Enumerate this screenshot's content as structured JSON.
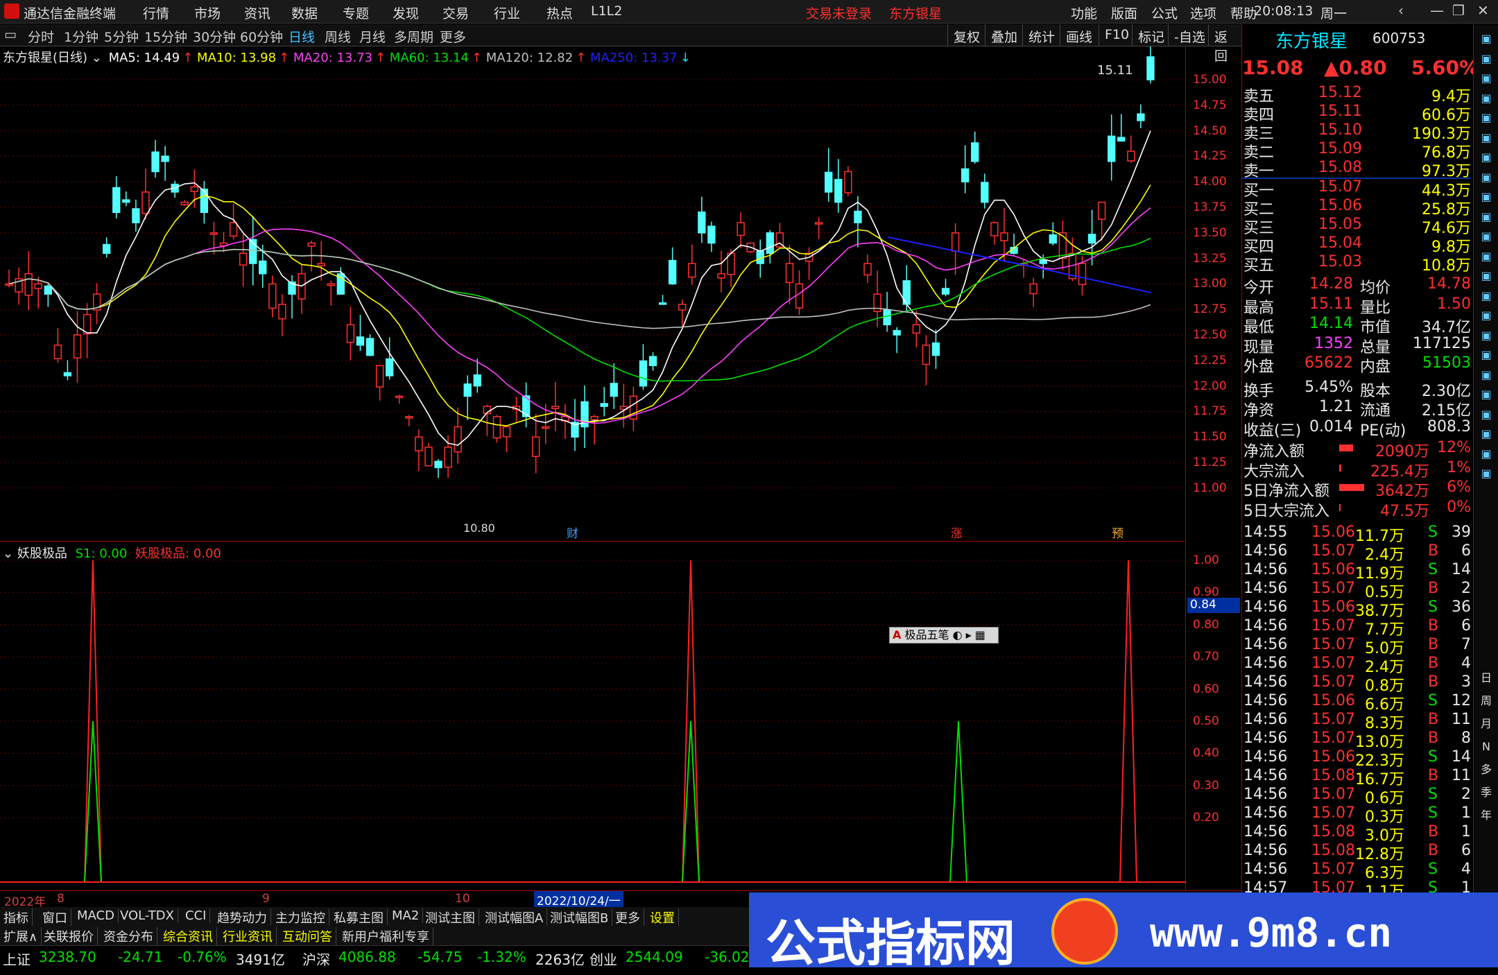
{
  "app": {
    "title": "通达信金融终端",
    "menus": [
      "行情",
      "市场",
      "资讯",
      "数据",
      "专题",
      "发现",
      "交易",
      "行业",
      "热点",
      "L1L2"
    ],
    "center_links": [
      "交易未登录",
      "东方银星"
    ],
    "right_menus": [
      "功能",
      "版面",
      "公式",
      "选项",
      "帮助"
    ],
    "clock": "20:08:13",
    "weekday": "周一"
  },
  "periods": {
    "items": [
      "分时",
      "1分钟",
      "5分钟",
      "15分钟",
      "30分钟",
      "60分钟",
      "日线",
      "周线",
      "月线",
      "多周期",
      "更多"
    ],
    "active": "日线",
    "right_buttons": [
      "复权",
      "叠加",
      "统计",
      "画线",
      "F10",
      "标记",
      "-自选",
      "返回"
    ]
  },
  "main_legend": {
    "name": "东方银星(日线)",
    "ma": [
      {
        "label": "MA5: 14.49",
        "color": "#ffffff"
      },
      {
        "label": "MA10: 13.98",
        "color": "#ffff00"
      },
      {
        "label": "MA20: 13.73",
        "color": "#ff40ff"
      },
      {
        "label": "MA60: 13.14",
        "color": "#00e000"
      },
      {
        "label": "MA120: 12.82",
        "color": "#c0c0c0"
      },
      {
        "label": "MA250: 13.37",
        "color": "#2020ff"
      }
    ]
  },
  "price_axis": [
    "15.00",
    "14.75",
    "14.50",
    "14.25",
    "14.00",
    "13.75",
    "13.50",
    "13.25",
    "13.00",
    "12.75",
    "12.50",
    "12.25",
    "12.00",
    "11.75",
    "11.50",
    "11.25",
    "11.00"
  ],
  "annotations": {
    "high": "15.11",
    "low": "10.80",
    "events": [
      "财",
      "涨",
      "预"
    ]
  },
  "indicator": {
    "title": "妖股极品",
    "s1": "S1: 0.00",
    "v": "妖股极品: 0.00",
    "axis": [
      "1.00",
      "0.90",
      "0.80",
      "0.70",
      "0.60",
      "0.50",
      "0.40",
      "0.30",
      "0.20"
    ],
    "cursor_value": "0.84",
    "popup": "极品五笔"
  },
  "stock": {
    "name": "东方银星",
    "code": "600753",
    "price": "15.08",
    "change": "▲0.80",
    "pct": "5.60%"
  },
  "asks": [
    {
      "l": "卖五",
      "p": "15.12",
      "v": "9.4万"
    },
    {
      "l": "卖四",
      "p": "15.11",
      "v": "60.6万"
    },
    {
      "l": "卖三",
      "p": "15.10",
      "v": "190.3万"
    },
    {
      "l": "卖二",
      "p": "15.09",
      "v": "76.8万"
    },
    {
      "l": "卖一",
      "p": "15.08",
      "v": "97.3万"
    }
  ],
  "bids": [
    {
      "l": "买一",
      "p": "15.07",
      "v": "44.3万"
    },
    {
      "l": "买二",
      "p": "15.06",
      "v": "25.8万"
    },
    {
      "l": "买三",
      "p": "15.05",
      "v": "74.6万"
    },
    {
      "l": "买四",
      "p": "15.04",
      "v": "9.8万"
    },
    {
      "l": "买五",
      "p": "15.03",
      "v": "10.8万"
    }
  ],
  "stats": [
    {
      "a": "今开",
      "av": "14.28",
      "ac": "up",
      "b": "均价",
      "bv": "14.78",
      "bc": "up"
    },
    {
      "a": "最高",
      "av": "15.11",
      "ac": "up",
      "b": "量比",
      "bv": "1.50",
      "bc": "up"
    },
    {
      "a": "最低",
      "av": "14.14",
      "ac": "dn",
      "b": "市值",
      "bv": "34.7亿",
      "bc": "wh"
    },
    {
      "a": "现量",
      "av": "1352",
      "ac": "mg",
      "b": "总量",
      "bv": "117125",
      "bc": "wh"
    },
    {
      "a": "外盘",
      "av": "65622",
      "ac": "up",
      "b": "内盘",
      "bv": "51503",
      "bc": "dn"
    },
    {
      "a": "换手",
      "av": "5.45%",
      "ac": "wh",
      "b": "股本",
      "bv": "2.30亿",
      "bc": "wh"
    },
    {
      "a": "净资",
      "av": "1.21",
      "ac": "wh",
      "b": "流通",
      "bv": "2.15亿",
      "bc": "wh"
    },
    {
      "a": "收益(三)",
      "av": "0.014",
      "ac": "wh",
      "b": "PE(动)",
      "bv": "808.3",
      "bc": "wh"
    }
  ],
  "flows": [
    {
      "l": "净流入额",
      "v": "2090万",
      "p": "12%"
    },
    {
      "l": "大宗流入",
      "v": "225.4万",
      "p": "1%"
    },
    {
      "l": "5日净流入额",
      "v": "3642万",
      "p": "6%"
    },
    {
      "l": "5日大宗流入",
      "v": "47.5万",
      "p": "0%"
    }
  ],
  "ticks": [
    [
      "14:55",
      "15.06",
      "11.7万",
      "S",
      "39"
    ],
    [
      "14:56",
      "15.07",
      "2.4万",
      "B",
      "6"
    ],
    [
      "14:56",
      "15.06",
      "11.9万",
      "S",
      "14"
    ],
    [
      "14:56",
      "15.07",
      "0.5万",
      "B",
      "2"
    ],
    [
      "14:56",
      "15.06",
      "38.7万",
      "S",
      "36"
    ],
    [
      "14:56",
      "15.07",
      "7.7万",
      "B",
      "6"
    ],
    [
      "14:56",
      "15.07",
      "5.0万",
      "B",
      "7"
    ],
    [
      "14:56",
      "15.07",
      "2.4万",
      "B",
      "4"
    ],
    [
      "14:56",
      "15.07",
      "0.8万",
      "B",
      "3"
    ],
    [
      "14:56",
      "15.06",
      "6.6万",
      "S",
      "12"
    ],
    [
      "14:56",
      "15.07",
      "8.3万",
      "B",
      "11"
    ],
    [
      "14:56",
      "15.07",
      "13.0万",
      "B",
      "8"
    ],
    [
      "14:56",
      "15.06",
      "22.3万",
      "S",
      "14"
    ],
    [
      "14:56",
      "15.08",
      "16.7万",
      "B",
      "11"
    ],
    [
      "14:56",
      "15.07",
      "0.6万",
      "S",
      "2"
    ],
    [
      "14:56",
      "15.07",
      "0.3万",
      "S",
      "1"
    ],
    [
      "14:56",
      "15.08",
      "3.0万",
      "B",
      "1"
    ],
    [
      "14:56",
      "15.08",
      "12.8万",
      "B",
      "6"
    ],
    [
      "14:56",
      "15.07",
      "6.3万",
      "S",
      "4"
    ],
    [
      "14:57",
      "15.07",
      "1.1万",
      "S",
      "1"
    ]
  ],
  "side_icons": [
    "日",
    "周",
    "月",
    "N",
    "多",
    "季",
    "年"
  ],
  "datebar": {
    "year": "2022年",
    "m1": "8",
    "m2": "9",
    "m3": "10",
    "cursor": "2022/10/24/一"
  },
  "tabs1": [
    "指标",
    "窗口",
    "MACD",
    "VOL-TDX",
    "CCI",
    "趋势动力",
    "主力监控",
    "私募主图",
    "MA2",
    "测试主图",
    "测试幅图A",
    "测试幅图B",
    "更多",
    "设置"
  ],
  "tabs2": [
    "扩展∧",
    "关联报价",
    "资金分布",
    "综合资讯",
    "行业资讯",
    "互动问答",
    "新用户福利专享"
  ],
  "index_bar": [
    {
      "n": "上证",
      "v": "3238.70",
      "c": "-24.71",
      "p": "-0.76%",
      "a": "3491亿"
    },
    {
      "n": "沪深",
      "v": "4086.88",
      "c": "-54.75",
      "p": "-1.32%",
      "a": "2263亿"
    },
    {
      "n": "创业",
      "v": "2544.09",
      "c": "-36.02",
      "p": "",
      "a": ""
    }
  ],
  "banner": {
    "text": "公式指标网",
    "url": "www.9m8.cn"
  }
}
